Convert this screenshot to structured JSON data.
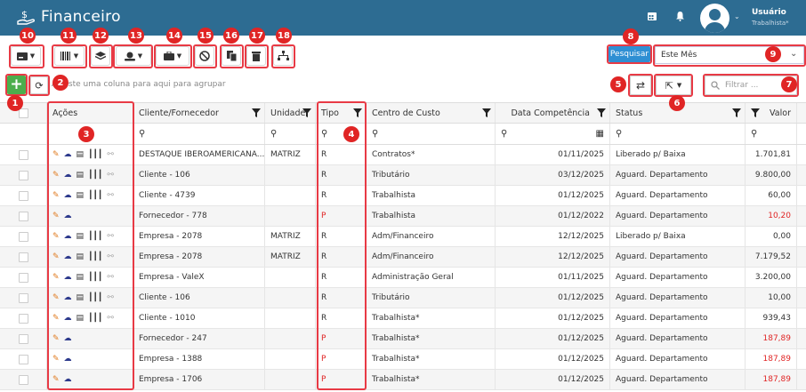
{
  "app": {
    "title": "Financeiro"
  },
  "user": {
    "name": "Usuário",
    "role": "Trabalhista*"
  },
  "toolbar": {
    "search_button": "Pesquisar",
    "period_value": "Este Mês",
    "group_hint": "Arraste uma coluna para aqui para agrupar",
    "filter_placeholder": "Filtrar ..."
  },
  "badges": [
    "1",
    "2",
    "3",
    "4",
    "5",
    "6",
    "7",
    "8",
    "9",
    "10",
    "11",
    "12",
    "13",
    "14",
    "15",
    "16",
    "17",
    "18"
  ],
  "columns": {
    "acoes": "Ações",
    "cliente": "Cliente/Fornecedor",
    "unidade": "Unidade",
    "tipo": "Tipo",
    "centro": "Centro de Custo",
    "data": "Data Competência",
    "status": "Status",
    "valor": "Valor"
  },
  "rows": [
    {
      "cliente": "DESTAQUE IBEROAMERICANA...",
      "unidade": "MATRIZ",
      "tipo": "R",
      "centro": "Contratos*",
      "data": "01/11/2025",
      "status": "Liberado p/ Baixa",
      "valor": "1.701,81",
      "full": true,
      "neg": false
    },
    {
      "cliente": "Cliente - 106",
      "unidade": "",
      "tipo": "R",
      "centro": "Tributário",
      "data": "03/12/2025",
      "status": "Aguard. Departamento",
      "valor": "9.800,00",
      "full": true,
      "neg": false
    },
    {
      "cliente": "Cliente - 4739",
      "unidade": "",
      "tipo": "R",
      "centro": "Trabalhista",
      "data": "01/12/2025",
      "status": "Aguard. Departamento",
      "valor": "60,00",
      "full": true,
      "neg": false
    },
    {
      "cliente": "Fornecedor - 778",
      "unidade": "",
      "tipo": "P",
      "centro": "Trabalhista",
      "data": "01/12/2022",
      "status": "Aguard. Departamento",
      "valor": "10,20",
      "full": false,
      "neg": true
    },
    {
      "cliente": "Empresa - 2078",
      "unidade": "MATRIZ",
      "tipo": "R",
      "centro": "Adm/Financeiro",
      "data": "12/12/2025",
      "status": "Liberado p/ Baixa",
      "valor": "0,00",
      "full": true,
      "neg": false
    },
    {
      "cliente": "Empresa - 2078",
      "unidade": "MATRIZ",
      "tipo": "R",
      "centro": "Adm/Financeiro",
      "data": "12/12/2025",
      "status": "Aguard. Departamento",
      "valor": "7.179,52",
      "full": true,
      "neg": false
    },
    {
      "cliente": "Empresa - ValeX",
      "unidade": "",
      "tipo": "R",
      "centro": "Administração Geral",
      "data": "01/11/2025",
      "status": "Aguard. Departamento",
      "valor": "3.200,00",
      "full": true,
      "neg": false
    },
    {
      "cliente": "Cliente - 106",
      "unidade": "",
      "tipo": "R",
      "centro": "Tributário",
      "data": "01/12/2025",
      "status": "Aguard. Departamento",
      "valor": "10,00",
      "full": true,
      "neg": false
    },
    {
      "cliente": "Cliente - 1010",
      "unidade": "",
      "tipo": "R",
      "centro": "Trabalhista*",
      "data": "01/12/2025",
      "status": "Aguard. Departamento",
      "valor": "939,43",
      "full": true,
      "neg": false
    },
    {
      "cliente": "Fornecedor - 247",
      "unidade": "",
      "tipo": "P",
      "centro": "Trabalhista*",
      "data": "01/12/2025",
      "status": "Aguard. Departamento",
      "valor": "187,89",
      "full": false,
      "neg": true
    },
    {
      "cliente": "Empresa - 1388",
      "unidade": "",
      "tipo": "P",
      "centro": "Trabalhista*",
      "data": "01/12/2025",
      "status": "Aguard. Departamento",
      "valor": "187,89",
      "full": false,
      "neg": true
    },
    {
      "cliente": "Empresa - 1706",
      "unidade": "",
      "tipo": "P",
      "centro": "Trabalhista*",
      "data": "01/12/2025",
      "status": "Aguard. Departamento",
      "valor": "187,89",
      "full": false,
      "neg": true
    }
  ],
  "colors": {
    "header": "#2d6c92",
    "accent": "#2f8fd3",
    "add": "#4cae4c",
    "highlight": "#e83a45",
    "badge": "#e02525",
    "payable": "#e02525"
  }
}
